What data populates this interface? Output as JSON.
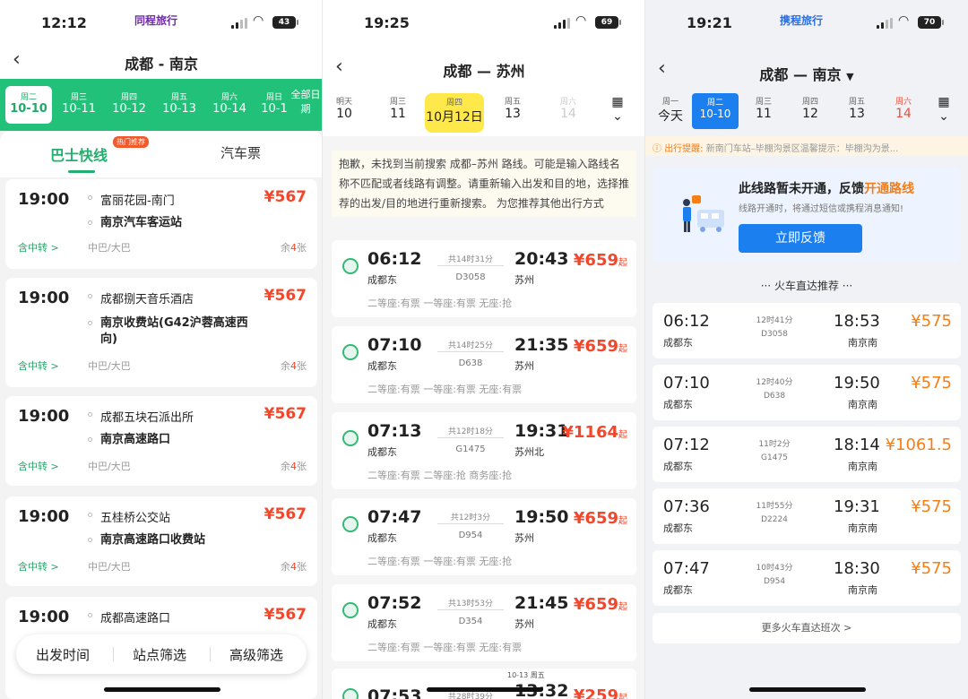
{
  "panel1": {
    "time": "12:12",
    "brand": "同程旅行",
    "battery": "43",
    "title": "成都 - 南京",
    "dates": [
      {
        "week": "周二",
        "day": "10-10",
        "selected": true
      },
      {
        "week": "周三",
        "day": "10-11"
      },
      {
        "week": "周四",
        "day": "10-12"
      },
      {
        "week": "周五",
        "day": "10-13"
      },
      {
        "week": "周六",
        "day": "10-14"
      },
      {
        "week": "周日",
        "day": "10-1"
      }
    ],
    "all_dates": "全部日期",
    "tab_bus": "巴士快线",
    "tab_hot": "热门推荐",
    "tab_ticket": "汽车票",
    "cards": [
      {
        "time": "19:00",
        "from": "富丽花园-南门",
        "to": "南京汽车客运站",
        "price": "¥567",
        "transfer": "含中转 >",
        "type": "中巴/大巴",
        "left_pre": "余",
        "left_num": "4",
        "left_suf": "张"
      },
      {
        "time": "19:00",
        "from": "成都捌天音乐酒店",
        "to": "南京收费站(G42沪蓉高速西向)",
        "price": "¥567",
        "transfer": "含中转 >",
        "type": "中巴/大巴",
        "left_pre": "余",
        "left_num": "4",
        "left_suf": "张"
      },
      {
        "time": "19:00",
        "from": "成都五块石派出所",
        "to": "南京高速路口",
        "price": "¥567",
        "transfer": "含中转 >",
        "type": "中巴/大巴",
        "left_pre": "余",
        "left_num": "4",
        "left_suf": "张"
      },
      {
        "time": "19:00",
        "from": "五桂桥公交站",
        "to": "南京高速路口收费站",
        "price": "¥567",
        "transfer": "含中转 >",
        "type": "中巴/大巴",
        "left_pre": "余",
        "left_num": "4",
        "left_suf": "张"
      },
      {
        "time": "19:00",
        "from": "成都高速路口",
        "to": "",
        "price": "¥567",
        "transfer": "",
        "type": "",
        "left_pre": "",
        "left_num": "",
        "left_suf": ""
      }
    ],
    "filters": [
      "出发时间",
      "站点筛选",
      "高级筛选"
    ]
  },
  "panel2": {
    "time": "19:25",
    "battery": "69",
    "title": "成都 — 苏州",
    "dates": [
      {
        "week": "明天",
        "day": "10"
      },
      {
        "week": "周三",
        "day": "11"
      },
      {
        "week": "周四",
        "day": "10月12日",
        "selected": true
      },
      {
        "week": "周五",
        "day": "13"
      },
      {
        "week": "周六",
        "day": "14",
        "disabled": true
      }
    ],
    "notice": "抱歉，未找到当前搜索 成都–苏州 路线。可能是输入路线名称不匹配或者线路有调整。请重新输入出发和目的地，选择推荐的出发/目的地进行重新搜索。 为您推荐其他出行方式",
    "trains": [
      {
        "dep": "06:12",
        "dep_st": "成都东",
        "dur": "共14时31分",
        "no": "D3058",
        "arr": "20:43",
        "arr_st": "苏州",
        "price": "¥659",
        "suffix": "起",
        "seats": "二等座:有票   一等座:有票   无座:抢"
      },
      {
        "dep": "07:10",
        "dep_st": "成都东",
        "dur": "共14时25分",
        "no": "D638",
        "arr": "21:35",
        "arr_st": "苏州",
        "price": "¥659",
        "suffix": "起",
        "seats": "二等座:有票   一等座:有票   无座:有票"
      },
      {
        "dep": "07:13",
        "dep_st": "成都东",
        "dur": "共12时18分",
        "no": "G1475",
        "arr": "19:31",
        "arr_st": "苏州北",
        "price": "¥1164",
        "suffix": "起",
        "seats": "二等座:有票   二等座:抢   商务座:抢"
      },
      {
        "dep": "07:47",
        "dep_st": "成都东",
        "dur": "共12时3分",
        "no": "D954",
        "arr": "19:50",
        "arr_st": "苏州",
        "price": "¥659",
        "suffix": "起",
        "seats": "二等座:有票   一等座:有票   无座:抢"
      },
      {
        "dep": "07:52",
        "dep_st": "成都东",
        "dur": "共13时53分",
        "no": "D354",
        "arr": "21:45",
        "arr_st": "苏州",
        "price": "¥659",
        "suffix": "起",
        "seats": "二等座:有票   一等座:有票   无座:有票"
      },
      {
        "dep": "07:53",
        "dep_st": "",
        "dur": "共28时39分",
        "no": "",
        "arr": "13:32",
        "arr_st": "",
        "price": "¥259",
        "suffix": "起",
        "seats": "",
        "date_note": "10-13 周五"
      }
    ]
  },
  "panel3": {
    "time": "19:21",
    "brand": "携程旅行",
    "battery": "70",
    "title": "成都 — 南京",
    "dates": [
      {
        "week": "周一",
        "day": "今天"
      },
      {
        "week": "周二",
        "day": "10-10",
        "selected": true
      },
      {
        "week": "周三",
        "day": "11"
      },
      {
        "week": "周四",
        "day": "12"
      },
      {
        "week": "周五",
        "day": "13"
      },
      {
        "week": "周六",
        "day": "14",
        "weekend": true
      }
    ],
    "notice_label": "出行提醒:",
    "notice_text": "新南门车站–毕棚沟景区温馨提示：毕棚沟为景...",
    "feedback": {
      "title_pre": "此线路暂未开通，反馈",
      "title_hl": "开通路线",
      "sub": "线路开通时，将通过短信或携程消息通知!",
      "button": "立即反馈"
    },
    "section_title": "··· 火车直达推荐 ···",
    "trains": [
      {
        "dep": "06:12",
        "dep_st": "成都东",
        "dur": "12时41分",
        "no": "D3058",
        "arr": "18:53",
        "arr_st": "南京南",
        "price": "¥575"
      },
      {
        "dep": "07:10",
        "dep_st": "成都东",
        "dur": "12时40分",
        "no": "D638",
        "arr": "19:50",
        "arr_st": "南京南",
        "price": "¥575"
      },
      {
        "dep": "07:12",
        "dep_st": "成都东",
        "dur": "11时2分",
        "no": "G1475",
        "arr": "18:14",
        "arr_st": "南京南",
        "price": "¥1061.5"
      },
      {
        "dep": "07:36",
        "dep_st": "成都东",
        "dur": "11时55分",
        "no": "D2224",
        "arr": "19:31",
        "arr_st": "南京南",
        "price": "¥575"
      },
      {
        "dep": "07:47",
        "dep_st": "成都东",
        "dur": "10时43分",
        "no": "D954",
        "arr": "18:30",
        "arr_st": "南京南",
        "price": "¥575"
      }
    ],
    "more": "更多火车直达班次 >"
  }
}
